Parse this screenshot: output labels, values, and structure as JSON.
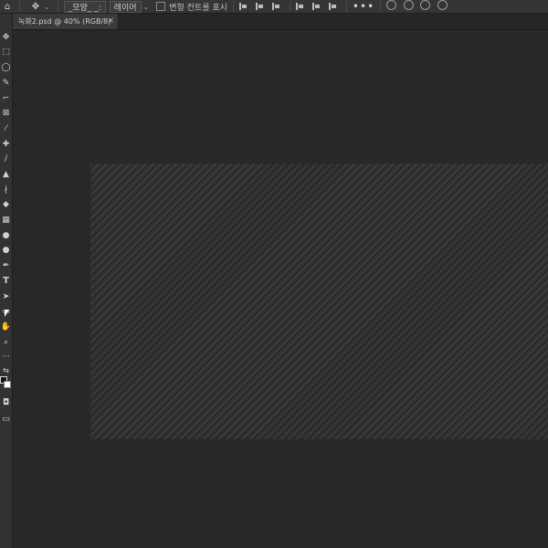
{
  "options_bar": {
    "auto_select_label": "_모양_ _:",
    "layer_select": "레이어",
    "show_transform_label": "변형 컨트롤 표시",
    "more": "•••"
  },
  "document_tab": {
    "title": "녹화2.psd @ 40% (RGB/8)",
    "close": "×"
  },
  "toolbar": {
    "tools": [
      "move",
      "marquee",
      "lasso",
      "quick-select",
      "crop",
      "frame",
      "eyedropper",
      "healing",
      "brush",
      "stamp",
      "history-brush",
      "eraser",
      "gradient",
      "blur",
      "dodge",
      "pen",
      "type",
      "path-select",
      "rectangle",
      "hand",
      "zoom",
      "more",
      "swap-colors"
    ],
    "foreground_color": "#111111",
    "background_color": "#ffffff"
  },
  "colors": {
    "ui_dark": "#282828",
    "panel": "#323232",
    "pattern_light": "#3b3b3b",
    "pattern_dark": "#2c2c2c"
  }
}
